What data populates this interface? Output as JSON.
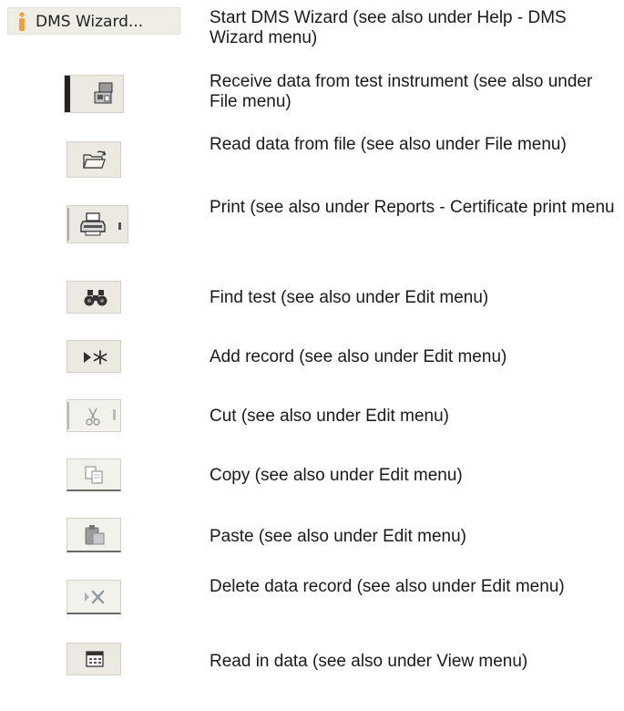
{
  "wizard_button": {
    "label": "DMS Wizard..."
  },
  "rows": [
    {
      "icon": "dms-wizard-person-icon",
      "text": "Start DMS Wizard (see also under Help - DMS Wizard menu)"
    },
    {
      "icon": "receive-data-instrument-icon",
      "text": "Receive data from test instrument (see also under File menu)"
    },
    {
      "icon": "open-folder-icon",
      "text": "Read data from file (see also under File menu)"
    },
    {
      "icon": "printer-icon",
      "text": "Print (see also under Reports - Certificate print menu"
    },
    {
      "icon": "binoculars-icon",
      "text": "Find test (see also under Edit menu)"
    },
    {
      "icon": "add-record-icon",
      "text": "Add record (see also under Edit menu)"
    },
    {
      "icon": "scissors-icon",
      "text": "Cut (see also under Edit menu)"
    },
    {
      "icon": "copy-icon",
      "text": "Copy (see also under Edit menu)"
    },
    {
      "icon": "paste-icon",
      "text": "Paste (see also under Edit menu)"
    },
    {
      "icon": "delete-record-icon",
      "text": "Delete data record (see also under Edit menu)"
    },
    {
      "icon": "read-in-data-icon",
      "text": "Read in data (see also under View menu)"
    }
  ],
  "colors": {
    "accent_orange": "#f0a040",
    "toolbar_gray": "#ece9e2",
    "icon_dark": "#3a3a3a"
  }
}
